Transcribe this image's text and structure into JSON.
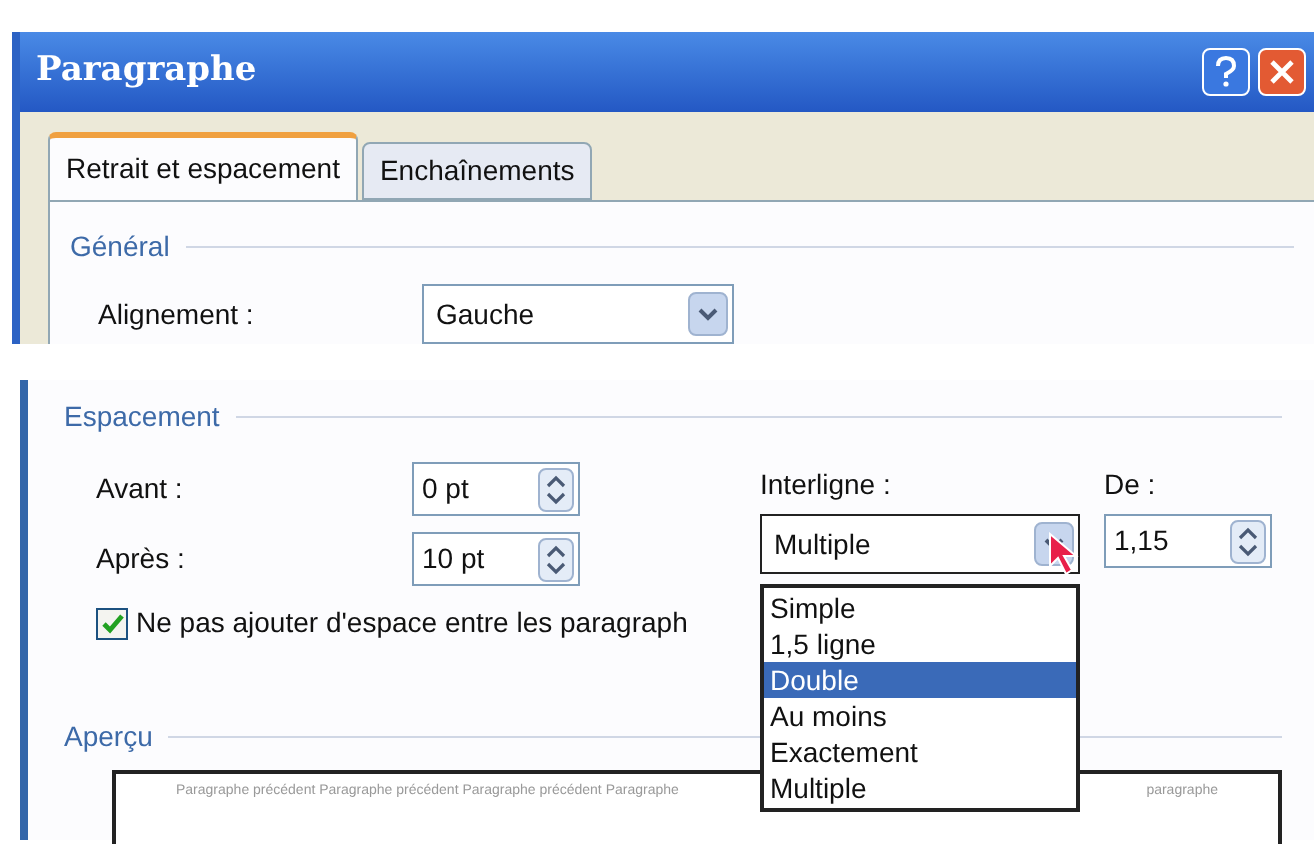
{
  "window": {
    "title": "Paragraphe"
  },
  "tabs": [
    {
      "label": "Retrait et espacement",
      "selected": true
    },
    {
      "label": "Enchaînements",
      "selected": false
    }
  ],
  "general": {
    "heading": "Général",
    "alignment": {
      "label": "Alignement :",
      "value": "Gauche"
    }
  },
  "spacing": {
    "heading": "Espacement",
    "before": {
      "label": "Avant :",
      "value": "0 pt"
    },
    "after": {
      "label": "Après :",
      "value": "10 pt"
    },
    "line_spacing": {
      "label": "Interligne :",
      "value": "Multiple",
      "expanded": true,
      "options": [
        {
          "label": "Simple",
          "highlighted": false
        },
        {
          "label": "1,5 ligne",
          "highlighted": false
        },
        {
          "label": "Double",
          "highlighted": true
        },
        {
          "label": "Au moins",
          "highlighted": false
        },
        {
          "label": "Exactement",
          "highlighted": false
        },
        {
          "label": "Multiple",
          "highlighted": false
        }
      ]
    },
    "at": {
      "label": "De :",
      "value": "1,15"
    },
    "no_space": {
      "label": "Ne pas ajouter d'espace entre les paragraph",
      "checked": true
    }
  },
  "preview": {
    "heading": "Aperçu",
    "text_left": "Paragraphe précédent Paragraphe précédent Paragraphe précédent Paragraphe",
    "text_right": "paragraphe"
  }
}
